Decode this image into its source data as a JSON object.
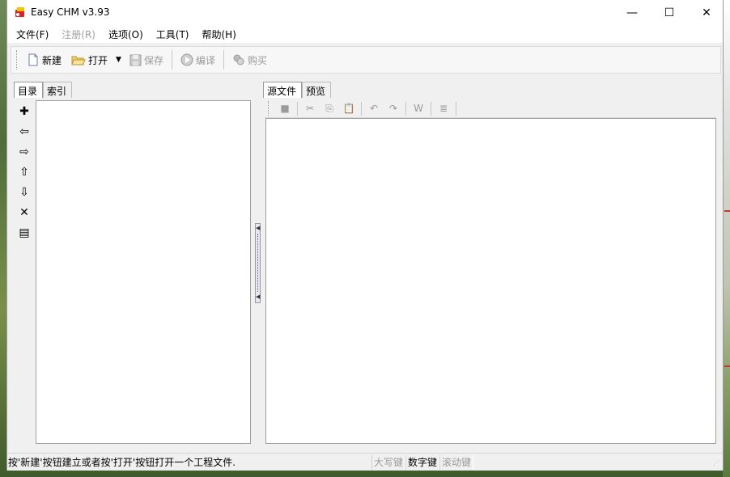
{
  "window": {
    "title": "Easy CHM v3.93"
  },
  "window_controls": {
    "minimize": "—",
    "maximize": "☐",
    "close": "✕"
  },
  "menu": [
    {
      "label": "文件(F)",
      "enabled": true
    },
    {
      "label": "注册(R)",
      "enabled": false
    },
    {
      "label": "选项(O)",
      "enabled": true
    },
    {
      "label": "工具(T)",
      "enabled": true
    },
    {
      "label": "帮助(H)",
      "enabled": true
    }
  ],
  "toolbar": {
    "new_label": "新建",
    "open_label": "打开",
    "save_label": "保存",
    "compile_label": "编译",
    "buy_label": "购买"
  },
  "left_panel": {
    "tabs": [
      "目录",
      "索引"
    ],
    "tools": [
      {
        "icon": "add-icon",
        "glyph": "✚"
      },
      {
        "icon": "arrow-left-icon",
        "glyph": "⇦"
      },
      {
        "icon": "arrow-right-icon",
        "glyph": "⇨"
      },
      {
        "icon": "arrow-up-icon",
        "glyph": "⇧"
      },
      {
        "icon": "arrow-down-icon",
        "glyph": "⇩"
      },
      {
        "icon": "delete-icon",
        "glyph": "✕"
      },
      {
        "icon": "properties-icon",
        "glyph": "▤"
      }
    ]
  },
  "right_panel": {
    "tabs": [
      "源文件",
      "预览"
    ],
    "editor_tools": [
      {
        "icon": "stop-icon",
        "glyph": "■"
      },
      {
        "icon": "cut-icon",
        "glyph": "✂"
      },
      {
        "icon": "copy-icon",
        "glyph": "⎘"
      },
      {
        "icon": "paste-icon",
        "glyph": "📋"
      },
      {
        "icon": "undo-icon",
        "glyph": "↶"
      },
      {
        "icon": "redo-icon",
        "glyph": "↷"
      },
      {
        "icon": "word-wrap-icon",
        "glyph": "W"
      },
      {
        "icon": "format-icon",
        "glyph": "≣"
      }
    ]
  },
  "statusbar": {
    "message": "按'新建'按钮建立或者按'打开'按钮打开一个工程文件.",
    "caps_lock": "大写键",
    "num_lock": "数字键",
    "scroll_lock": "滚动键"
  }
}
